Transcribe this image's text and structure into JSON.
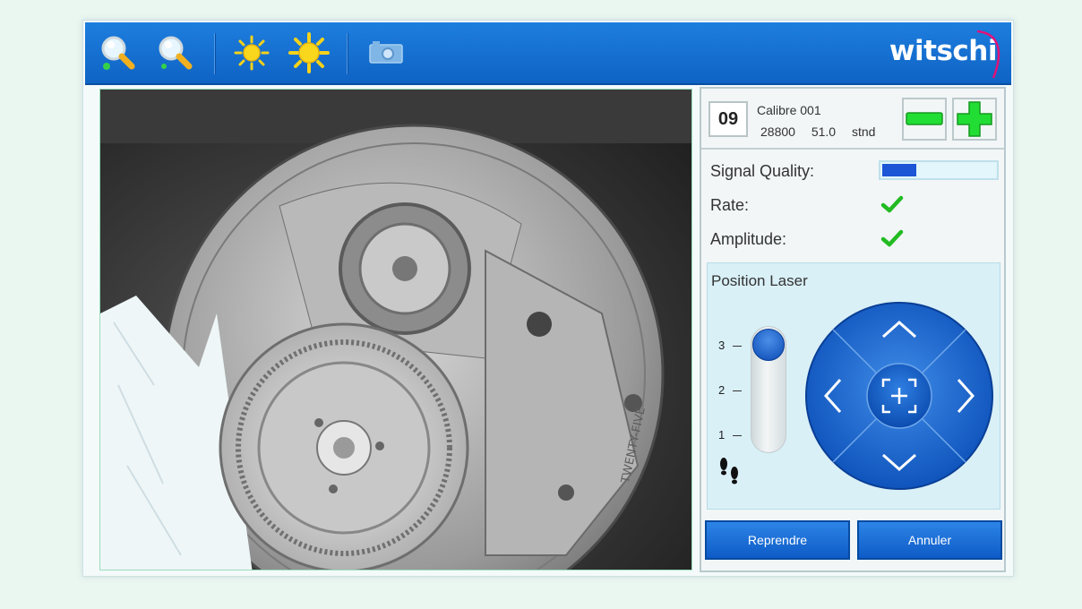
{
  "brand": {
    "logo": "witschi"
  },
  "toolbar": {
    "icons": [
      "zoom-in-icon",
      "zoom-out-icon",
      "brightness-low-icon",
      "brightness-high-icon",
      "camera-icon"
    ]
  },
  "camera": {
    "subject": "watch-movement"
  },
  "calibre": {
    "number": "09",
    "name": "Calibre 001",
    "values": "28800 51.0 stnd",
    "decrease_icon": "minus-icon",
    "increase_icon": "plus-icon"
  },
  "status": {
    "signal_label": "Signal Quality:",
    "signal_level": 0.3,
    "rate_label": "Rate:",
    "rate_ok": true,
    "amplitude_label": "Amplitude:",
    "amplitude_ok": true
  },
  "laser": {
    "title": "Position Laser",
    "levels": [
      "3",
      "2",
      "1"
    ],
    "current_level": 3,
    "footsteps_icon": "footsteps-icon",
    "dpad_icons": [
      "arrow-up-icon",
      "arrow-down-icon",
      "arrow-left-icon",
      "arrow-right-icon",
      "center-focus-icon"
    ]
  },
  "actions": {
    "resume": "Reprendre",
    "cancel": "Annuler"
  },
  "colors": {
    "toolbar": "#1570d6",
    "accent": "#0e5cc7",
    "check": "#22bb22",
    "plus_minus": "#22dd33"
  }
}
